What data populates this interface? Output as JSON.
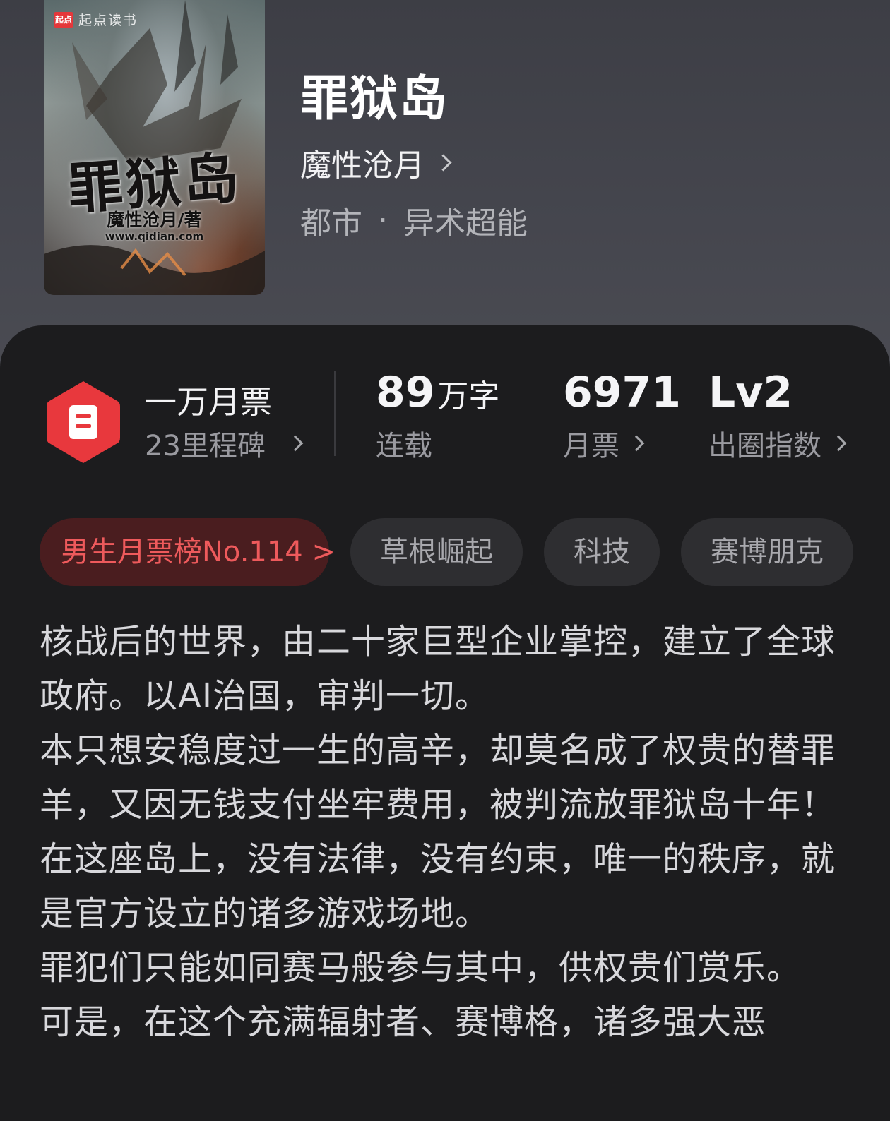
{
  "book": {
    "cover": {
      "brand_logo": "起点",
      "brand_text": "起点读书",
      "title": "罪狱岛",
      "author": "魔性沧月/著",
      "url": "www.qidian.com"
    },
    "title": "罪狱岛",
    "author": "魔性沧月",
    "genre_main": "都市",
    "genre_separator": "·",
    "genre_sub": "异术超能"
  },
  "stats": {
    "milestone": {
      "title": "一万月票",
      "subtitle": "23里程碑",
      "icon": "ticket-icon",
      "badge_color": "#e8383d"
    },
    "word_count": {
      "value": "89",
      "unit": "万字",
      "label": "连载"
    },
    "monthly_votes": {
      "value": "6971",
      "label": "月票"
    },
    "popularity": {
      "value": "Lv2",
      "label": "出圈指数"
    }
  },
  "tags": [
    {
      "label": "男生月票榜No.114 >",
      "kind": "rank",
      "color": "#ee5a5c"
    },
    {
      "label": "草根崛起",
      "kind": "normal"
    },
    {
      "label": "科技",
      "kind": "normal"
    },
    {
      "label": "赛博朋克",
      "kind": "normal"
    }
  ],
  "synopsis": {
    "paragraphs": [
      "核战后的世界，由二十家巨型企业掌控，建立了全球政府。以AI治国，审判一切。",
      "本只想安稳度过一生的高辛，却莫名成了权贵的替罪羊，又因无钱支付坐牢费用，被判流放罪狱岛十年！",
      "在这座岛上，没有法律，没有约束，唯一的秩序，就是官方设立的诸多游戏场地。",
      "罪犯们只能如同赛马般参与其中，供权贵们赏乐。",
      "可是，在这个充满辐射者、赛博格，诸多强大恶"
    ]
  }
}
